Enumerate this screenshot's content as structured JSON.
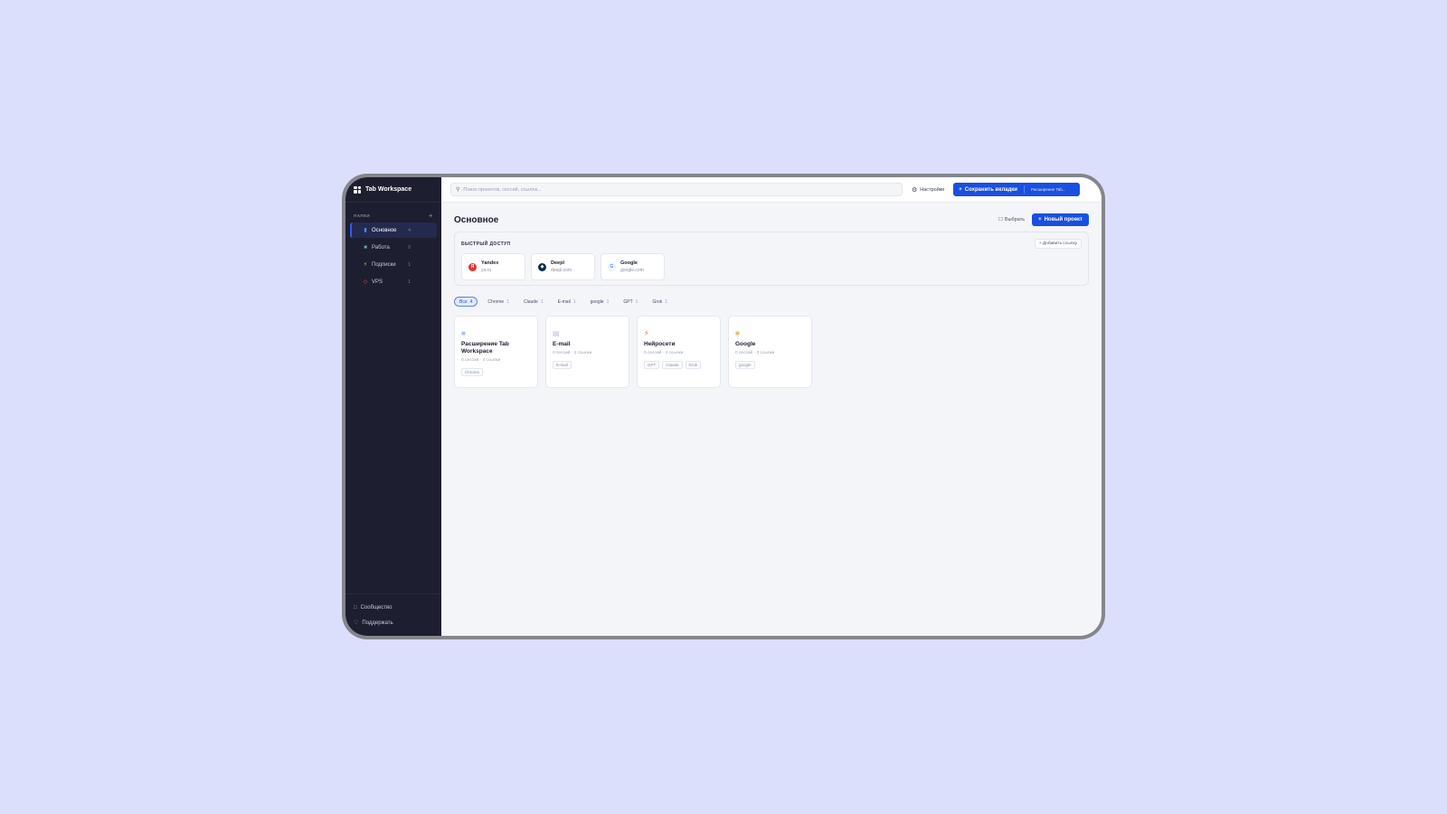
{
  "app": {
    "title": "Tab Workspace"
  },
  "sidebar": {
    "folders_label": "ПАПКИ",
    "add_symbol": "+",
    "folders": [
      {
        "label": "Основное",
        "count": "4",
        "icon": "bookmark-icon",
        "active": true
      },
      {
        "label": "Работа",
        "count": "0",
        "icon": "briefcase-icon"
      },
      {
        "label": "Подписки",
        "count": "1",
        "icon": "lightning-icon"
      },
      {
        "label": "VPS",
        "count": "1",
        "icon": "server-icon"
      }
    ],
    "bottom": [
      {
        "label": "Сообщество",
        "icon": "chat-icon"
      },
      {
        "label": "Поддержать",
        "icon": "heart-icon"
      }
    ]
  },
  "topbar": {
    "search_placeholder": "Поиск проектов, сессий, ссылок...",
    "settings_label": "Настройки",
    "save_label": "Сохранить вкладки",
    "extension_label": "Расширение Tab..."
  },
  "page": {
    "title": "Основное",
    "select_label": "Выбрать",
    "new_project_label": "Новый проект"
  },
  "quick_access": {
    "title": "БЫСТРЫЙ ДОСТУП",
    "add_link_label": "+ Добавить ссылку",
    "items": [
      {
        "name": "Yandex",
        "url": "ya.ru",
        "icon": "yandex-icon",
        "color": "#e5322d",
        "glyph": "Я"
      },
      {
        "name": "Deepl",
        "url": "deepl.com",
        "icon": "deepl-icon",
        "color": "#0f2b46",
        "glyph": "◆"
      },
      {
        "name": "Google",
        "url": "google.com",
        "icon": "google-icon",
        "color": "#ffffff",
        "glyph": "G"
      }
    ]
  },
  "filters": [
    {
      "label": "Все",
      "count": "4",
      "active": true
    },
    {
      "label": "Chrome",
      "count": "1"
    },
    {
      "label": "Claude",
      "count": "1"
    },
    {
      "label": "E-mail",
      "count": "1"
    },
    {
      "label": "google",
      "count": "1"
    },
    {
      "label": "GPT",
      "count": "1"
    },
    {
      "label": "Grok",
      "count": "1"
    }
  ],
  "projects": [
    {
      "name": "Расширение Tab Workspace",
      "meta": "0 сессий · 4 ссылки",
      "icon": "folder-icon",
      "tags": [
        "Chrome"
      ],
      "icon_color": "#a9c2ea"
    },
    {
      "name": "E-mail",
      "meta": "0 сессий · 2 ссылки",
      "icon": "archive-icon",
      "tags": [
        "E-mail"
      ],
      "icon_color": "#b9bed0"
    },
    {
      "name": "Нейросети",
      "meta": "0 сессий · 4 ссылки",
      "icon": "lightning-icon",
      "tags": [
        "GPT",
        "Claude",
        "Grok"
      ],
      "icon_color": "#e0684e"
    },
    {
      "name": "Google",
      "meta": "0 сессий · 3 ссылки",
      "icon": "folder-icon",
      "tags": [
        "google"
      ],
      "icon_color": "#f0b96a"
    }
  ]
}
